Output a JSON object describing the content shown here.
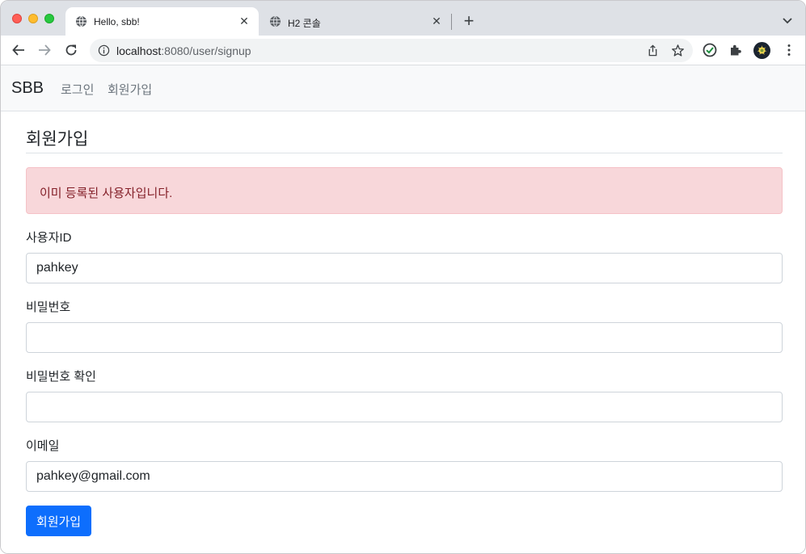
{
  "browser": {
    "tabs": [
      {
        "title": "Hello, sbb!",
        "active": true,
        "icon": "globe-icon"
      },
      {
        "title": "H2 콘솔",
        "active": false,
        "icon": "globe-icon"
      }
    ],
    "address": {
      "host": "localhost",
      "path": ":8080/user/signup"
    }
  },
  "navbar": {
    "brand": "SBB",
    "links": [
      "로그인",
      "회원가입"
    ]
  },
  "form": {
    "heading": "회원가입",
    "alert": "이미 등록된 사용자입니다.",
    "fields": [
      {
        "label": "사용자ID",
        "value": "pahkey",
        "type": "text"
      },
      {
        "label": "비밀번호",
        "value": "",
        "type": "password"
      },
      {
        "label": "비밀번호 확인",
        "value": "",
        "type": "password"
      },
      {
        "label": "이메일",
        "value": "pahkey@gmail.com",
        "type": "email"
      }
    ],
    "submit_label": "회원가입"
  },
  "colors": {
    "primary": "#0d6efd",
    "alert_bg": "#f8d7da",
    "alert_text": "#842029",
    "navbar_bg": "#f8f9fa"
  }
}
